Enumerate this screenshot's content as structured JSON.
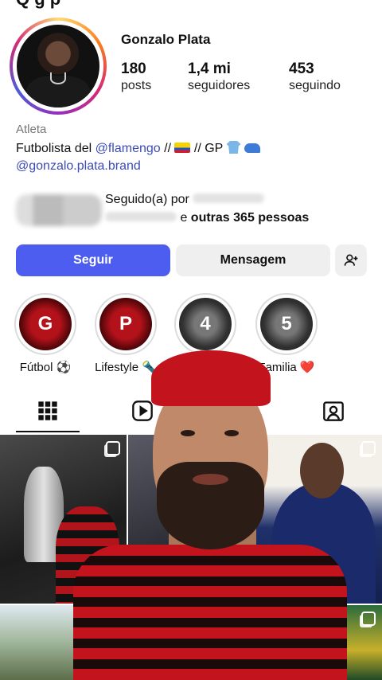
{
  "profile": {
    "username": "Gonzalo Plata",
    "stats": [
      {
        "value": "180",
        "label": "posts"
      },
      {
        "value": "1,4 mi",
        "label": "seguidores"
      },
      {
        "value": "453",
        "label": "seguindo"
      }
    ],
    "category": "Atleta",
    "bio": {
      "prefix": "Futbolista del ",
      "mention": "@flamengo",
      "middle": " // ",
      "after_flag": "  // GP ",
      "brand_link": "@gonzalo.plata.brand"
    },
    "followed_by": {
      "prefix": "Seguido(a) por ",
      "suffix": " e ",
      "others": "outras 365 pessoas"
    }
  },
  "actions": {
    "follow_label": "Seguir",
    "message_label": "Mensagem"
  },
  "highlights": [
    {
      "letter": "G",
      "label": "Fútbol ⚽"
    },
    {
      "letter": "P",
      "label": "Lifestyle 🔦"
    },
    {
      "letter": "4",
      "label": ""
    },
    {
      "letter": "5",
      "label": "Familia ❤️"
    }
  ],
  "tabs": [
    "grid-icon",
    "reels-icon",
    "tagged-icon"
  ],
  "colors": {
    "follow_button": "#4d5df0",
    "link": "#3b4bb8",
    "secondary_button": "#efefef"
  }
}
